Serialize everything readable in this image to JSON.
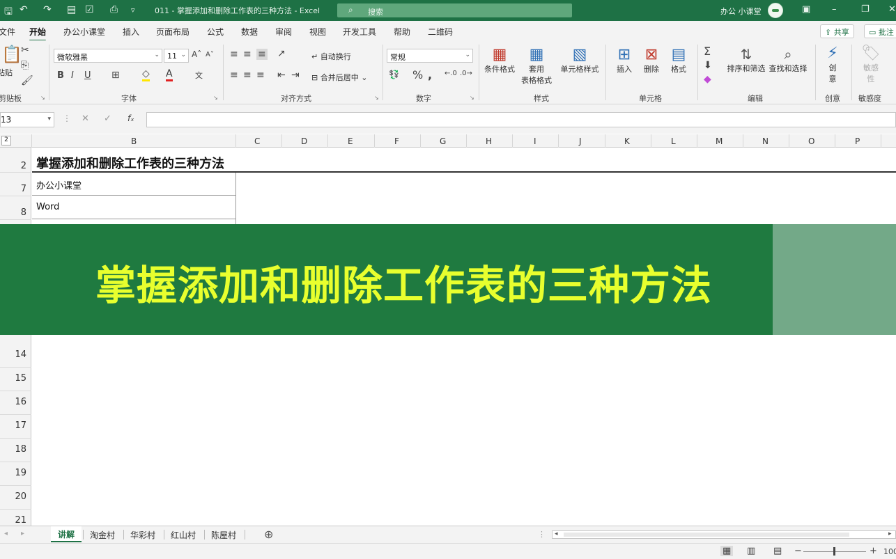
{
  "titlebar": {
    "doc_title": "011 - 掌握添加和删除工作表的三种方法  -  Excel",
    "search_placeholder": "搜索",
    "user_name": "办公 小课堂"
  },
  "ribbon_tabs": [
    "文件",
    "开始",
    "办公小课堂",
    "插入",
    "页面布局",
    "公式",
    "数据",
    "审阅",
    "视图",
    "开发工具",
    "帮助",
    "二维码"
  ],
  "ribbon_right": {
    "share": "共享",
    "comment": "批注"
  },
  "ribbon": {
    "clipboard": {
      "paste": "粘贴",
      "label": "剪贴板"
    },
    "font": {
      "name": "微软雅黑",
      "size": "11",
      "label": "字体"
    },
    "alignment": {
      "wrap": "自动换行",
      "merge": "合并后居中",
      "label": "对齐方式"
    },
    "number": {
      "format": "常规",
      "label": "数字"
    },
    "styles": {
      "conditional": "条件格式",
      "table_line1": "套用",
      "table_line2": "表格格式",
      "cell_styles": "单元格样式",
      "label": "样式"
    },
    "cells": {
      "insert": "插入",
      "delete": "删除",
      "format": "格式",
      "label": "单元格"
    },
    "editing": {
      "sort": "排序和筛选",
      "find": "查找和选择",
      "label": "编辑"
    },
    "creative": {
      "btn_line1": "创",
      "btn_line2": "意",
      "label": "创意"
    },
    "sensitivity": {
      "btn_line1": "敏感",
      "btn_line2": "性",
      "label": "敏感度"
    }
  },
  "formula_bar": {
    "name_box": "13",
    "content": ""
  },
  "columns": [
    "B",
    "C",
    "D",
    "E",
    "F",
    "G",
    "H",
    "I",
    "J",
    "K",
    "L",
    "M",
    "N",
    "O",
    "P"
  ],
  "rows": {
    "top": [
      "2",
      "7",
      "8"
    ],
    "bottom": [
      "14",
      "15",
      "16",
      "17",
      "18",
      "19",
      "20",
      "21"
    ]
  },
  "cells": {
    "b2": "掌握添加和删除工作表的三种方法",
    "b7": "办公小课堂",
    "b8": "Word"
  },
  "banner": {
    "text": "掌握添加和删除工作表的三种方法"
  },
  "sheet_tabs": [
    "讲解",
    "淘金村",
    "华彩村",
    "红山村",
    "陈屋村"
  ],
  "status": {
    "zoom": "100"
  },
  "colors": {
    "excel_green": "#1e7145",
    "banner_green": "#1f7a40",
    "banner_text": "#e8ff2e"
  }
}
